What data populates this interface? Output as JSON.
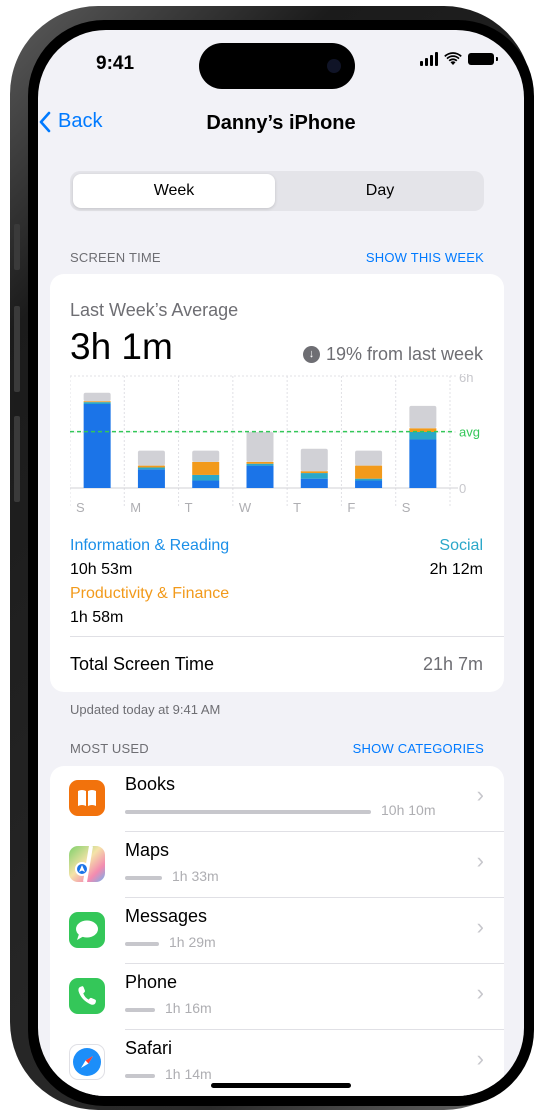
{
  "status": {
    "time": "9:41"
  },
  "nav": {
    "back_label": "Back",
    "title": "Danny’s iPhone"
  },
  "segments": {
    "week": "Week",
    "day": "Day",
    "selected": "Week"
  },
  "screen_time": {
    "section_label": "SCREEN TIME",
    "show_link": "SHOW THIS WEEK",
    "avg_label": "Last Week’s Average",
    "avg_value": "3h 1m",
    "change_text": "19% from last week",
    "chart_data": {
      "type": "bar",
      "stacked": true,
      "categories": [
        "S",
        "M",
        "T",
        "W",
        "T",
        "F",
        "S"
      ],
      "y_tick_labels": [
        "6h",
        "0"
      ],
      "ylim": [
        0,
        6
      ],
      "avg_label": "avg",
      "avg_value": 3.02,
      "series": [
        {
          "color": "#1b74e8",
          "values": [
            4.5,
            1.0,
            0.4,
            1.2,
            0.5,
            0.4,
            2.6
          ]
        },
        {
          "color": "#2aa7c9",
          "values": [
            0.1,
            0.1,
            0.3,
            0.1,
            0.3,
            0.1,
            0.4
          ]
        },
        {
          "color": "#f29a1b",
          "values": [
            0.05,
            0.1,
            0.7,
            0.1,
            0.1,
            0.7,
            0.2
          ]
        },
        {
          "color": "#d1d1d6",
          "values": [
            0.45,
            0.8,
            0.6,
            1.6,
            1.2,
            0.8,
            1.2
          ]
        }
      ],
      "grid": true
    },
    "legend": {
      "info_label": "Information & Reading",
      "info_value": "10h 53m",
      "productivity_label": "Productivity & Finance",
      "productivity_value": "1h 58m",
      "social_label": "Social",
      "social_value": "2h 12m"
    },
    "total_label": "Total Screen Time",
    "total_value": "21h 7m",
    "updated": "Updated today at 9:41 AM"
  },
  "most_used": {
    "section_label": "MOST USED",
    "show_link": "SHOW CATEGORIES",
    "apps": [
      {
        "name": "Books",
        "time": "10h 10m",
        "fraction": 1.0
      },
      {
        "name": "Maps",
        "time": "1h 33m",
        "fraction": 0.15
      },
      {
        "name": "Messages",
        "time": "1h 29m",
        "fraction": 0.14
      },
      {
        "name": "Phone",
        "time": "1h 16m",
        "fraction": 0.12
      },
      {
        "name": "Safari",
        "time": "1h 14m",
        "fraction": 0.12
      }
    ]
  }
}
